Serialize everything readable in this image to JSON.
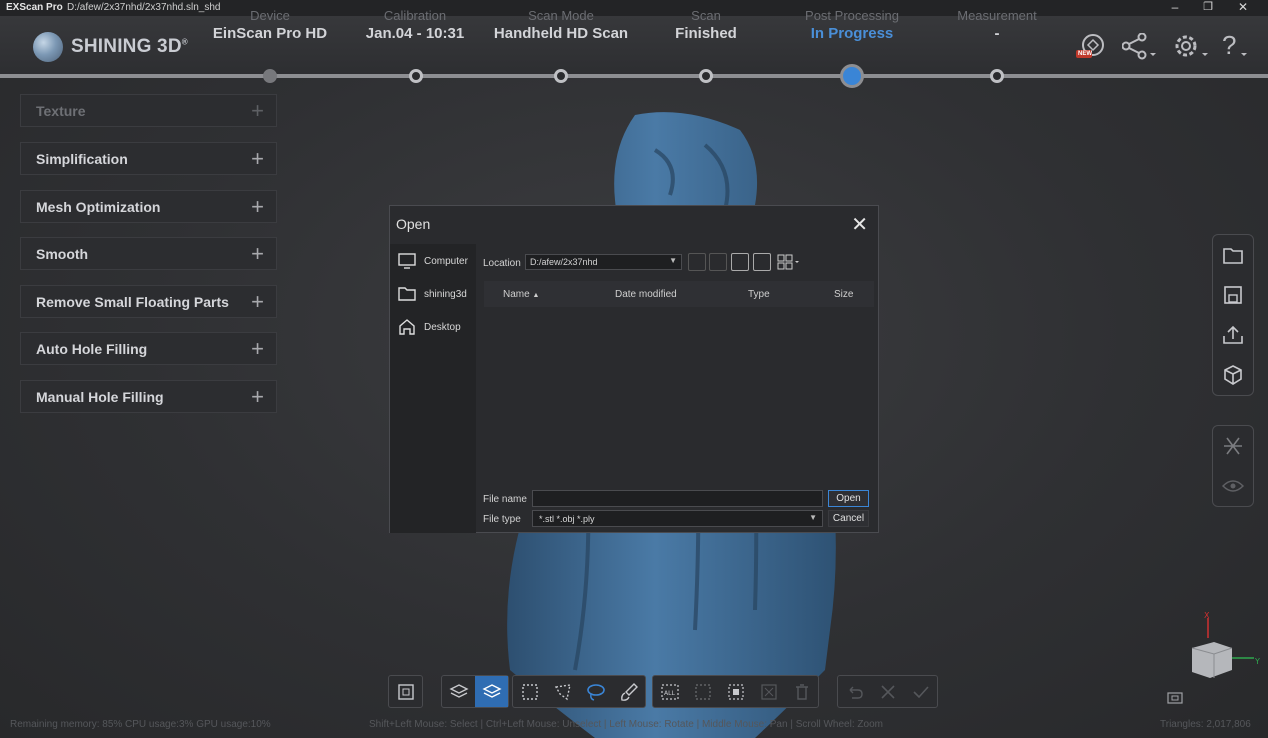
{
  "titlebar": {
    "app": "EXScan Pro",
    "path": "D:/afew/2x37nhd/2x37nhd.sln_shd",
    "minimize": "–",
    "restore": "❐",
    "close": "✕"
  },
  "brand": {
    "name": "SHINING 3D",
    "mark": "®"
  },
  "steps": [
    {
      "label": "Device",
      "value": "EinScan Pro HD"
    },
    {
      "label": "Calibration",
      "value": "Jan.04 - 10:31"
    },
    {
      "label": "Scan Mode",
      "value": "Handheld HD Scan"
    },
    {
      "label": "Scan",
      "value": "Finished"
    },
    {
      "label": "Post Processing",
      "value": "In Progress"
    },
    {
      "label": "Measurement",
      "value": "-"
    }
  ],
  "header_icons": {
    "new_badge": "NEW",
    "share": "share-icon",
    "settings": "gear-icon",
    "help": "?"
  },
  "panels": [
    {
      "label": "Texture",
      "enabled": false
    },
    {
      "label": "Simplification",
      "enabled": true
    },
    {
      "label": "Mesh Optimization",
      "enabled": true
    },
    {
      "label": "Smooth",
      "enabled": true
    },
    {
      "label": "Remove Small Floating Parts",
      "enabled": true
    },
    {
      "label": "Auto Hole Filling",
      "enabled": true
    },
    {
      "label": "Manual Hole Filling",
      "enabled": true
    }
  ],
  "panel_plus": "+",
  "dialog": {
    "title": "Open",
    "close": "✕",
    "sidebar": [
      "Computer",
      "shining3d",
      "Desktop"
    ],
    "location_label": "Location",
    "location_value": "D:/afew/2x37nhd",
    "columns": [
      "Name",
      "Date modified",
      "Type",
      "Size"
    ],
    "sort_indicator": "▲",
    "file_name_label": "File name",
    "file_name_value": "",
    "file_type_label": "File type",
    "file_type_value": "*.stl  *.obj  *.ply",
    "open_button": "Open",
    "cancel_button": "Cancel"
  },
  "axis": {
    "x": "X",
    "y": "Y"
  },
  "status": {
    "resources": "Remaining memory: 85% CPU usage:3%  GPU usage:10%",
    "hints": "Shift+Left Mouse: Select | Ctrl+Left Mouse: Unselect | Left Mouse: Rotate | Middle Mouse: Pan | Scroll Wheel: Zoom",
    "triangles": "Triangles: 2,017,806"
  },
  "colors": {
    "accent": "#3a85d6",
    "model": "#3f6b94",
    "background": "#2f3033"
  }
}
